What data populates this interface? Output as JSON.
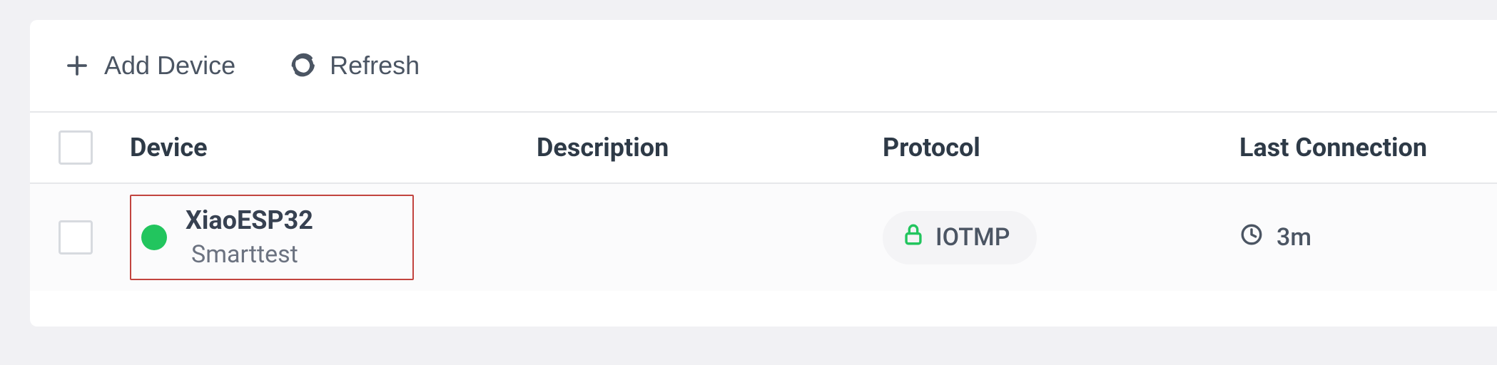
{
  "toolbar": {
    "add_label": "Add Device",
    "refresh_label": "Refresh"
  },
  "columns": {
    "device": "Device",
    "description": "Description",
    "protocol": "Protocol",
    "last_connection": "Last Connection"
  },
  "rows": [
    {
      "status": "online",
      "name": "XiaoESP32",
      "subtitle": "Smarttest",
      "description": "",
      "protocol": "IOTMP",
      "last_connection": "3m",
      "highlighted": true
    }
  ],
  "colors": {
    "online": "#22c55e",
    "highlight_border": "#c2443f"
  }
}
